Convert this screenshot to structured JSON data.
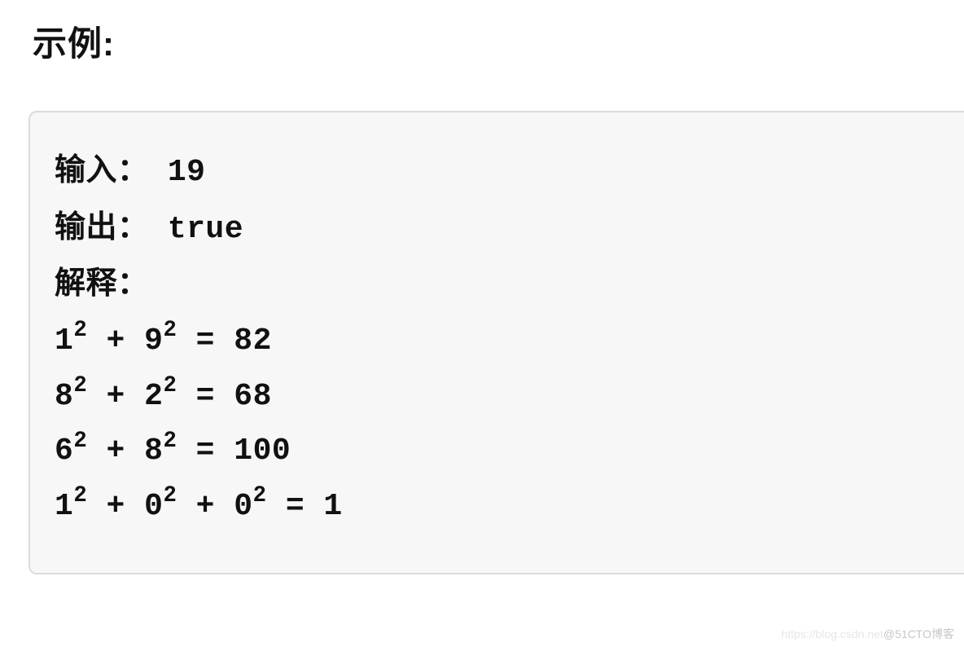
{
  "heading": "示例: ",
  "labels": {
    "input": "输入：",
    "output": "输出：",
    "explain": "解释："
  },
  "input_value": "19",
  "output_value": "true",
  "explanation": [
    {
      "terms": [
        {
          "base": "1",
          "exp": "2"
        },
        {
          "base": "9",
          "exp": "2"
        }
      ],
      "result": "82"
    },
    {
      "terms": [
        {
          "base": "8",
          "exp": "2"
        },
        {
          "base": "2",
          "exp": "2"
        }
      ],
      "result": "68"
    },
    {
      "terms": [
        {
          "base": "6",
          "exp": "2"
        },
        {
          "base": "8",
          "exp": "2"
        }
      ],
      "result": "100"
    },
    {
      "terms": [
        {
          "base": "1",
          "exp": "2"
        },
        {
          "base": "0",
          "exp": "2"
        },
        {
          "base": "0",
          "exp": "2"
        }
      ],
      "result": "1"
    }
  ],
  "watermark": {
    "faint": "https://blog.csdn.net",
    "dark": "@51CTO博客"
  }
}
